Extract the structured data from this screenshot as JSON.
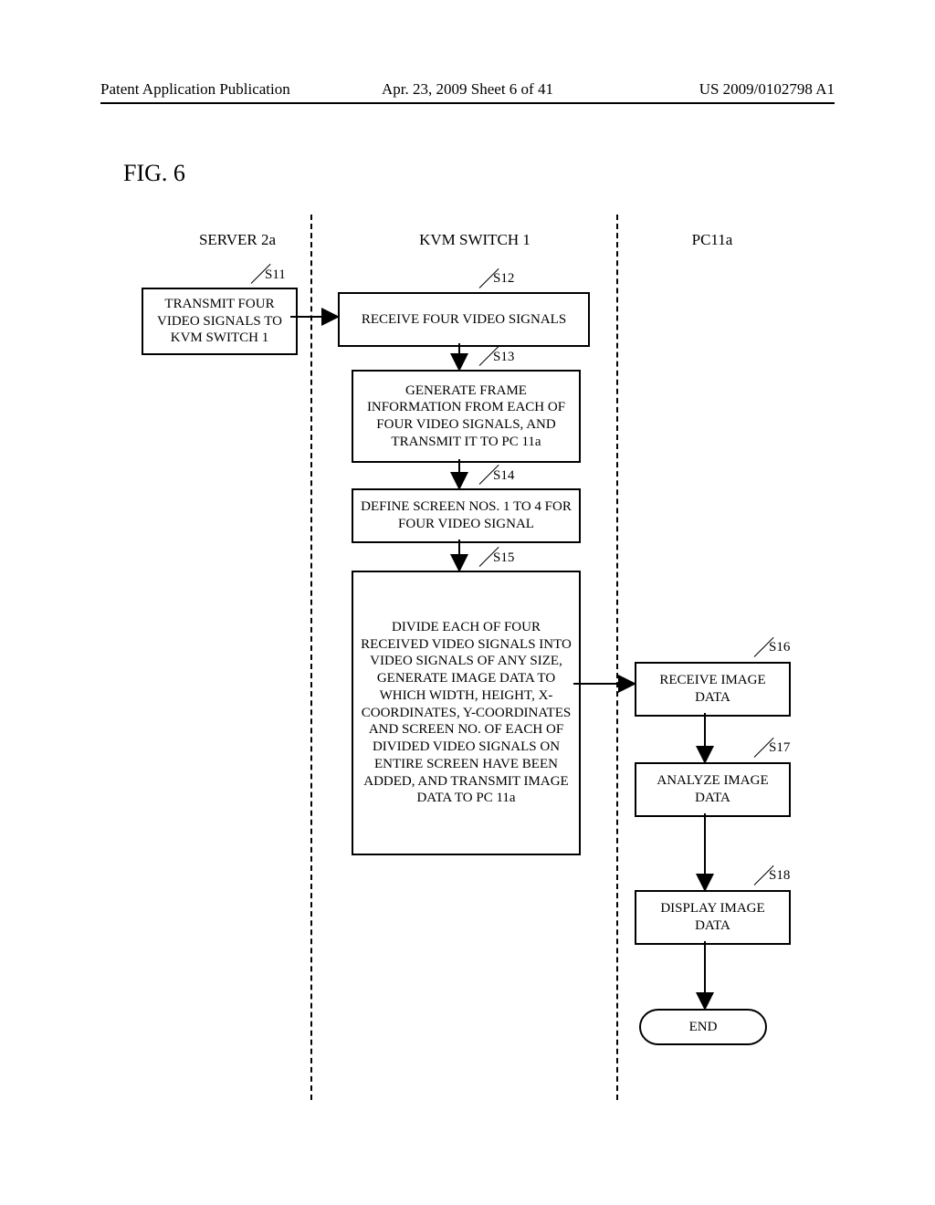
{
  "header": {
    "left": "Patent Application Publication",
    "center": "Apr. 23, 2009  Sheet 6 of 41",
    "right": "US 2009/0102798 A1"
  },
  "figure_label": "FIG. 6",
  "columns": {
    "a": "SERVER 2a",
    "b": "KVM SWITCH 1",
    "c": "PC11a"
  },
  "steps": {
    "s11": {
      "label": "S11",
      "text": "TRANSMIT FOUR VIDEO SIGNALS TO KVM SWITCH 1"
    },
    "s12": {
      "label": "S12",
      "text": "RECEIVE FOUR VIDEO SIGNALS"
    },
    "s13": {
      "label": "S13",
      "text": "GENERATE FRAME INFORMATION FROM EACH OF FOUR VIDEO SIGNALS, AND TRANSMIT IT TO PC 11a"
    },
    "s14": {
      "label": "S14",
      "text": "DEFINE SCREEN NOS. 1 TO 4 FOR FOUR VIDEO SIGNAL"
    },
    "s15": {
      "label": "S15",
      "text": "DIVIDE EACH OF FOUR RECEIVED VIDEO SIGNALS INTO VIDEO SIGNALS OF ANY SIZE, GENERATE IMAGE DATA TO WHICH WIDTH, HEIGHT, X-COORDINATES, Y-COORDINATES AND SCREEN NO. OF EACH OF DIVIDED VIDEO SIGNALS ON ENTIRE SCREEN HAVE BEEN ADDED, AND TRANSMIT IMAGE DATA TO PC 11a"
    },
    "s16": {
      "label": "S16",
      "text": "RECEIVE IMAGE DATA"
    },
    "s17": {
      "label": "S17",
      "text": "ANALYZE IMAGE DATA"
    },
    "s18": {
      "label": "S18",
      "text": "DISPLAY IMAGE DATA"
    }
  },
  "terminator": "END",
  "chart_data": {
    "type": "flowchart",
    "swimlanes": [
      "SERVER 2a",
      "KVM SWITCH 1",
      "PC11a"
    ],
    "nodes": [
      {
        "id": "S11",
        "lane": "SERVER 2a",
        "text": "TRANSMIT FOUR VIDEO SIGNALS TO KVM SWITCH 1"
      },
      {
        "id": "S12",
        "lane": "KVM SWITCH 1",
        "text": "RECEIVE FOUR VIDEO SIGNALS"
      },
      {
        "id": "S13",
        "lane": "KVM SWITCH 1",
        "text": "GENERATE FRAME INFORMATION FROM EACH OF FOUR VIDEO SIGNALS, AND TRANSMIT IT TO PC 11a"
      },
      {
        "id": "S14",
        "lane": "KVM SWITCH 1",
        "text": "DEFINE SCREEN NOS. 1 TO 4 FOR FOUR VIDEO SIGNAL"
      },
      {
        "id": "S15",
        "lane": "KVM SWITCH 1",
        "text": "DIVIDE EACH OF FOUR RECEIVED VIDEO SIGNALS INTO VIDEO SIGNALS OF ANY SIZE, GENERATE IMAGE DATA TO WHICH WIDTH, HEIGHT, X-COORDINATES, Y-COORDINATES AND SCREEN NO. OF EACH OF DIVIDED VIDEO SIGNALS ON ENTIRE SCREEN HAVE BEEN ADDED, AND TRANSMIT IMAGE DATA TO PC 11a"
      },
      {
        "id": "S16",
        "lane": "PC11a",
        "text": "RECEIVE IMAGE DATA"
      },
      {
        "id": "S17",
        "lane": "PC11a",
        "text": "ANALYZE IMAGE DATA"
      },
      {
        "id": "S18",
        "lane": "PC11a",
        "text": "DISPLAY IMAGE DATA"
      },
      {
        "id": "END",
        "lane": "PC11a",
        "text": "END",
        "shape": "terminator"
      }
    ],
    "edges": [
      {
        "from": "S11",
        "to": "S12"
      },
      {
        "from": "S12",
        "to": "S13"
      },
      {
        "from": "S13",
        "to": "S14"
      },
      {
        "from": "S14",
        "to": "S15"
      },
      {
        "from": "S15",
        "to": "S16"
      },
      {
        "from": "S16",
        "to": "S17"
      },
      {
        "from": "S17",
        "to": "S18"
      },
      {
        "from": "S18",
        "to": "END"
      }
    ]
  }
}
